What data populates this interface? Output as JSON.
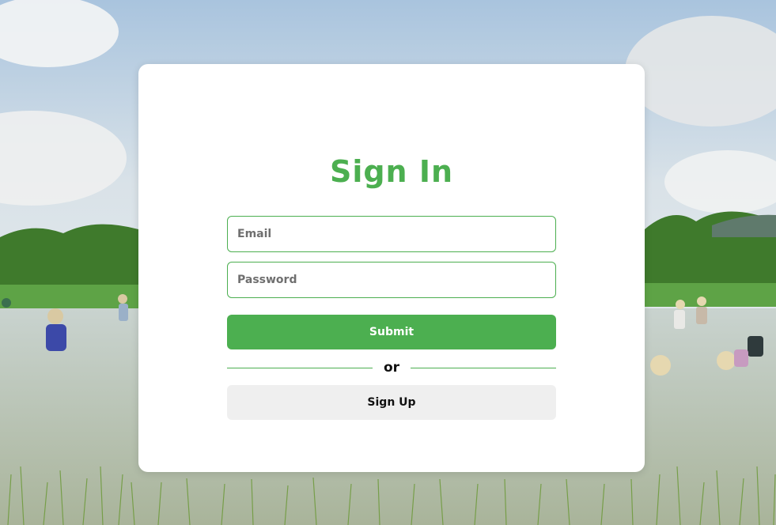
{
  "signin": {
    "title": "Sign In",
    "email_placeholder": "Email",
    "password_placeholder": "Password",
    "submit_label": "Submit",
    "divider_text": "or",
    "signup_label": "Sign Up"
  },
  "colors": {
    "accent": "#4caf50",
    "card": "#ffffff",
    "secondary_button": "#efefef"
  }
}
